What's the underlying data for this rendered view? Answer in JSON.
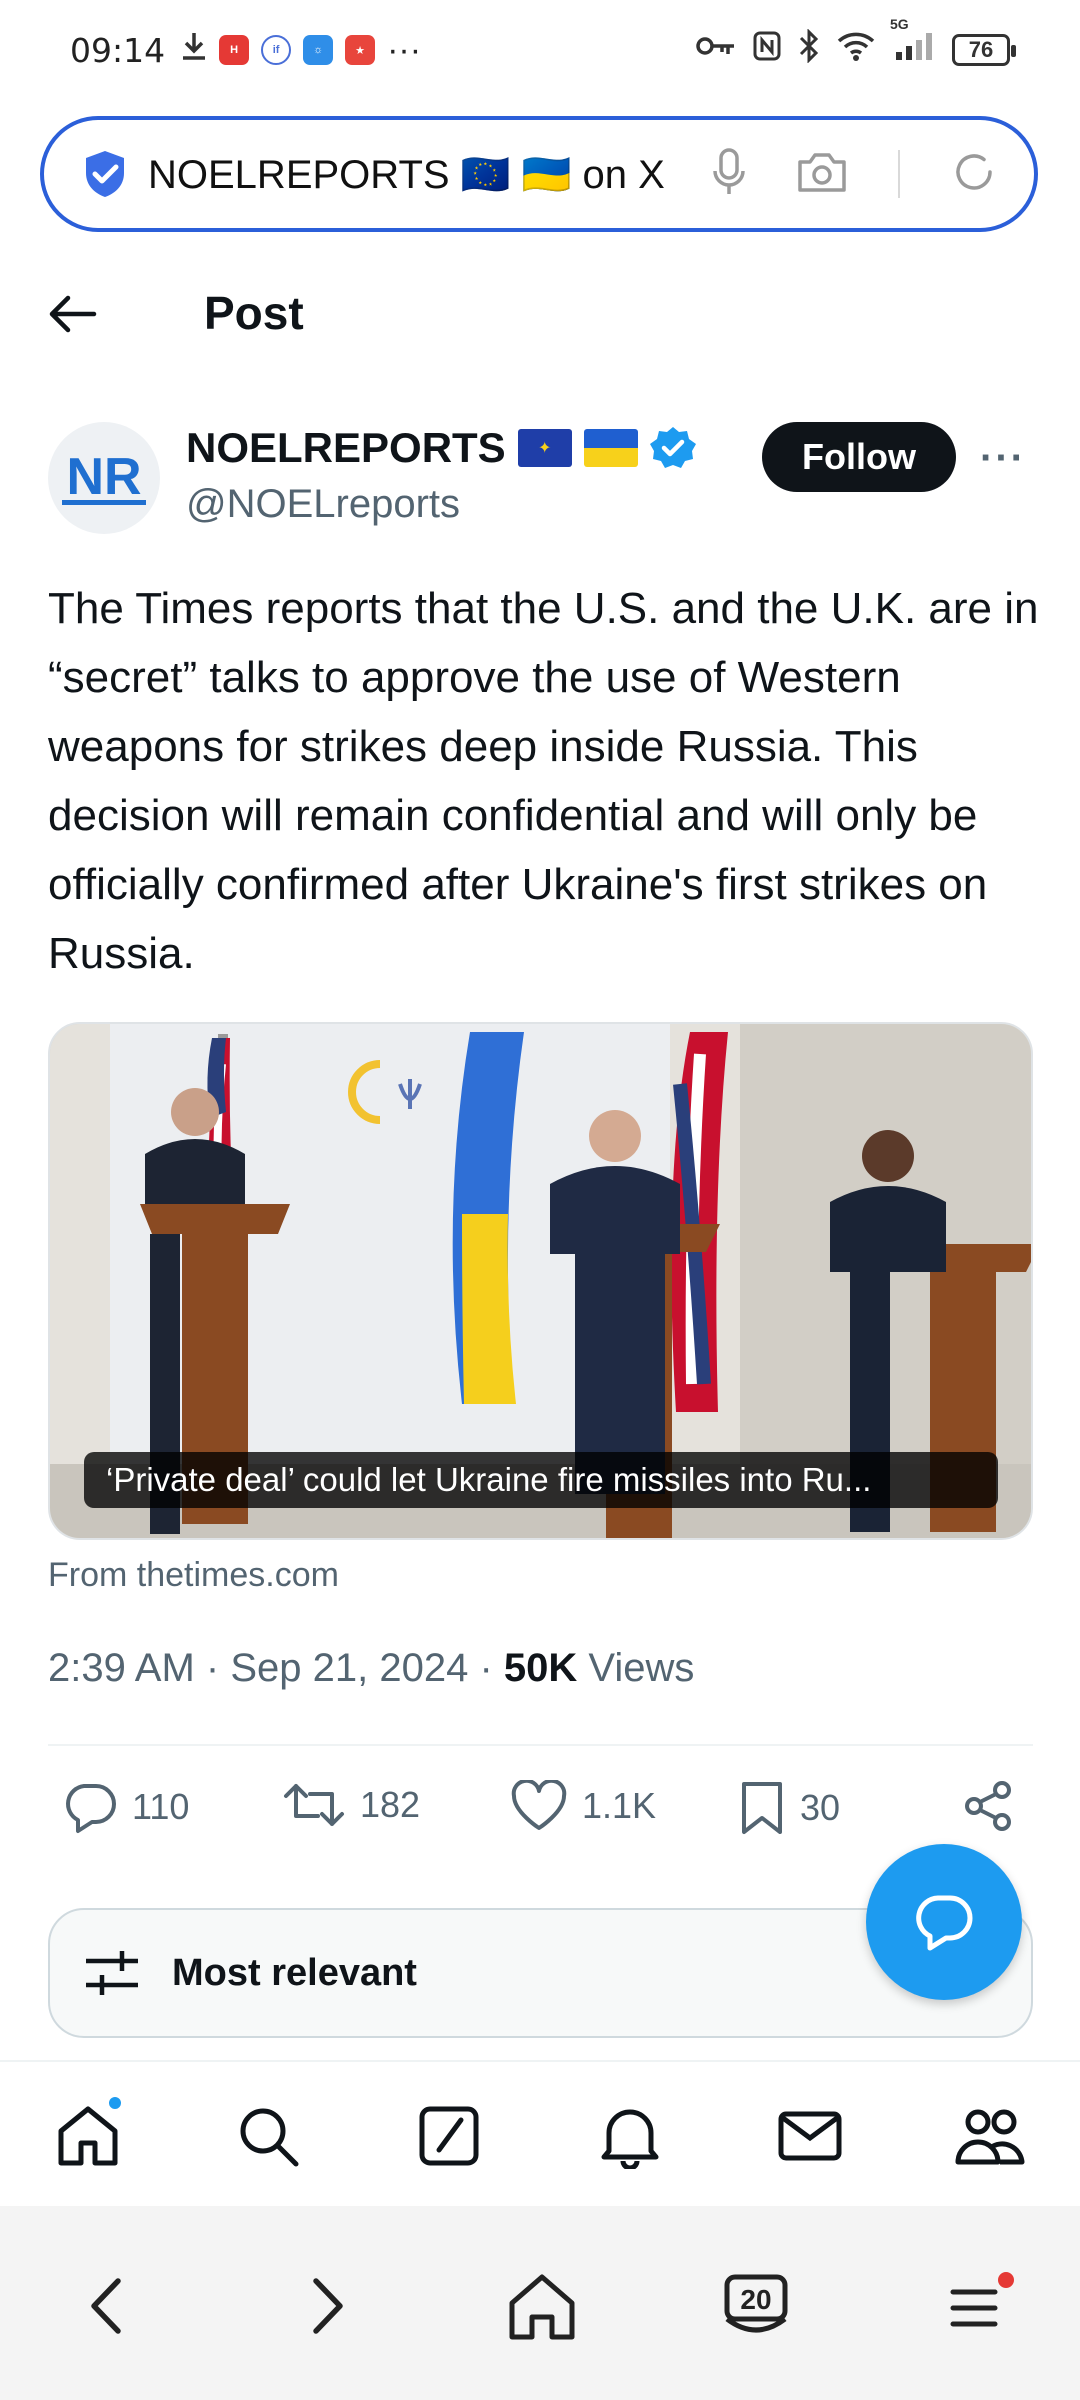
{
  "status_bar": {
    "time": "09:14",
    "more": "···",
    "battery": "76",
    "network": "5G"
  },
  "browser": {
    "url_text": "NOELREPORTS 🇪🇺 🇺🇦 on X"
  },
  "header": {
    "title": "Post"
  },
  "author": {
    "avatar_text": "NR",
    "name": "NOELREPORTS",
    "handle": "@NOELreports",
    "follow_label": "Follow"
  },
  "tweet": {
    "text": "The Times reports that the U.S. and the U.K. are in “secret” talks to approve the use of Western weapons for strikes deep inside Russia. This decision will remain confidential and will only be officially confirmed after Ukraine's first strikes on Russia.",
    "media_caption": "‘Private deal’ could let Ukraine fire missiles into Ru...",
    "source": "From thetimes.com",
    "time": "2:39 AM",
    "date": "Sep 21, 2024",
    "views_count": "50K",
    "views_label": "Views"
  },
  "actions": {
    "replies": "110",
    "reposts": "182",
    "likes": "1.1K",
    "bookmarks": "30"
  },
  "sort": {
    "label": "Most relevant"
  },
  "sysnav": {
    "tabs_count": "20"
  },
  "colors": {
    "accent": "#1d9bf0",
    "url_border": "#2b5fd9",
    "text_primary": "#0f1419",
    "text_secondary": "#536471"
  }
}
